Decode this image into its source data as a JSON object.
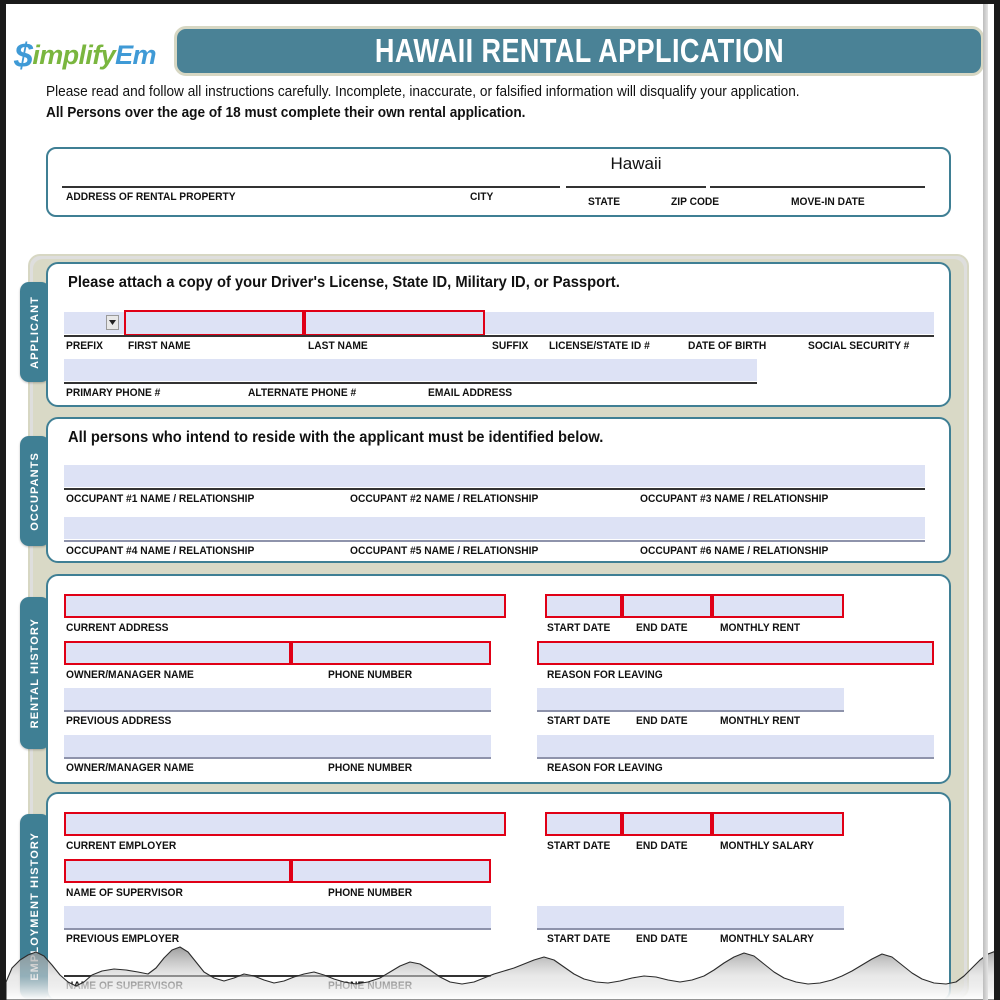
{
  "brand": {
    "dollar": "$",
    "part_green": "implify",
    "part_blue": "Em",
    "full": "SimplifyEm"
  },
  "header": {
    "title": "HAWAII RENTAL APPLICATION"
  },
  "instructions": {
    "line1": "Please read and follow all instructions carefully. Incomplete, inaccurate, or falsified information will disqualify your application.",
    "line2": "All Persons over the age of 18 must complete their own rental application."
  },
  "property": {
    "state_value": "Hawaii",
    "labels": {
      "address": "ADDRESS OF RENTAL PROPERTY",
      "city": "CITY",
      "state": "STATE",
      "zip": "ZIP CODE",
      "movein": "MOVE-IN DATE"
    }
  },
  "tabs": {
    "applicant": "APPLICANT",
    "occupants": "OCCUPANTS",
    "rental_history": "RENTAL HISTORY",
    "employment_history": "EMPLOYMENT HISTORY"
  },
  "applicant": {
    "title": "Please attach a copy of your Driver's License, State ID, Military ID, or Passport.",
    "prefix_value": "",
    "labels": {
      "prefix": "PREFIX",
      "first_name": "FIRST NAME",
      "last_name": "LAST NAME",
      "suffix": "SUFFIX",
      "license": "LICENSE/STATE ID #",
      "dob": "DATE OF BIRTH",
      "ssn": "SOCIAL SECURITY #",
      "primary_phone": "PRIMARY PHONE #",
      "alternate_phone": "ALTERNATE PHONE #",
      "email": "EMAIL ADDRESS"
    }
  },
  "occupants": {
    "title": "All persons who intend to reside with the applicant must be identified below.",
    "labels": [
      "OCCUPANT #1 NAME / RELATIONSHIP",
      "OCCUPANT #2 NAME / RELATIONSHIP",
      "OCCUPANT #3 NAME / RELATIONSHIP",
      "OCCUPANT #4 NAME / RELATIONSHIP",
      "OCCUPANT #5 NAME / RELATIONSHIP",
      "OCCUPANT #6 NAME / RELATIONSHIP"
    ]
  },
  "rental_history": {
    "labels": {
      "current_address": "CURRENT ADDRESS",
      "start_date": "START DATE",
      "end_date": "END DATE",
      "monthly_rent": "MONTHLY RENT",
      "owner_manager": "OWNER/MANAGER NAME",
      "phone_number": "PHONE NUMBER",
      "reason_leaving": "REASON FOR LEAVING",
      "previous_address": "PREVIOUS ADDRESS",
      "start_date2": "START DATE",
      "end_date2": "END DATE",
      "monthly_rent2": "MONTHLY RENT",
      "owner_manager2": "OWNER/MANAGER NAME",
      "phone_number2": "PHONE NUMBER",
      "reason_leaving2": "REASON FOR LEAVING"
    }
  },
  "employment_history": {
    "labels": {
      "current_employer": "CURRENT EMPLOYER",
      "start_date": "START DATE",
      "end_date": "END DATE",
      "monthly_salary": "MONTHLY SALARY",
      "supervisor": "NAME OF SUPERVISOR",
      "phone_number": "PHONE NUMBER",
      "previous_employer": "PREVIOUS EMPLOYER",
      "start_date2": "START DATE",
      "end_date2": "END DATE",
      "monthly_salary2": "MONTHLY SALARY",
      "supervisor2": "NAME OF SUPERVISOR",
      "phone_number2": "PHONE NUMBER"
    }
  },
  "colors": {
    "teal": "#4a8296",
    "panel_border": "#3f7f94",
    "field_fill": "#dde2f5",
    "required_border": "#e00016",
    "frame_beige": "#d9d9c6",
    "brand_green": "#7ab63f",
    "brand_blue": "#3f9ad6"
  }
}
